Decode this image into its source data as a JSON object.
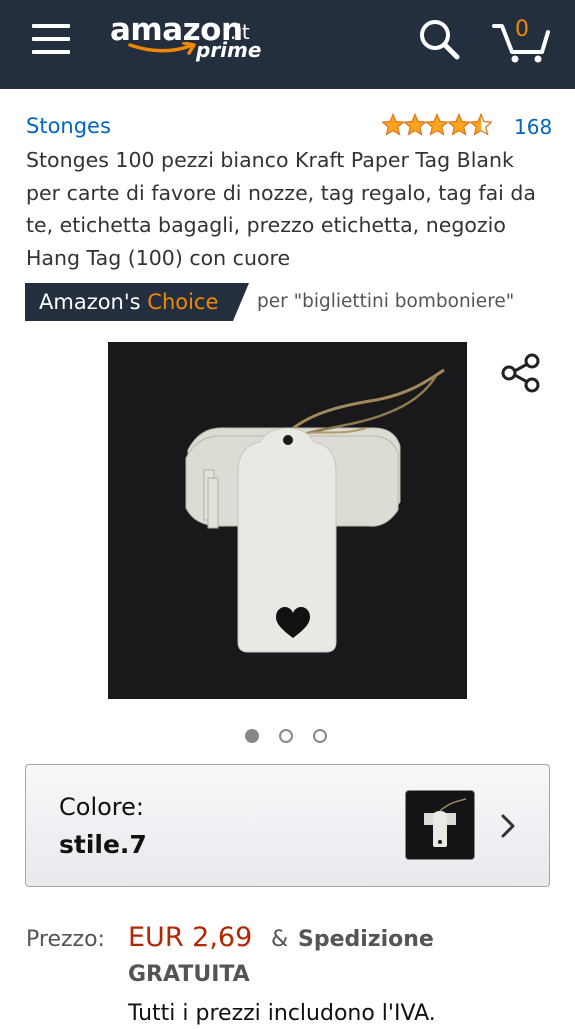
{
  "header": {
    "logo_word": "amazon",
    "logo_tld": ".it",
    "logo_prime": "prime",
    "cart_count": "0",
    "icons": [
      "menu-icon",
      "search-icon",
      "cart-icon"
    ]
  },
  "product": {
    "brand": "Stonges",
    "rating_stars": 4.5,
    "rating_count": "168",
    "title": "Stonges 100 pezzi bianco Kraft Paper Tag Blank per carte di favore di nozze, tag regalo, tag fai da te, etichetta bagagli, prezzo etichetta, negozio Hang Tag (100) con cuore",
    "choice_prefix": "Amazon's",
    "choice_word": "Choice",
    "choice_query": "per \"bigliettini bomboniere\"",
    "image_count": 3,
    "active_image": 0
  },
  "variation": {
    "label": "Colore:",
    "value": "stile.7"
  },
  "price": {
    "label": "Prezzo:",
    "value": "EUR 2,69",
    "amp": "&",
    "shipping_line1": "Spedizione",
    "shipping_line2": "GRATUITA",
    "vat_note": "Tutti i prezzi includono l'IVA."
  },
  "colors": {
    "header_bg": "#232f3e",
    "link": "#0066c0",
    "price": "#b12704",
    "accent_orange": "#f08804",
    "star": "#ffa41c"
  }
}
